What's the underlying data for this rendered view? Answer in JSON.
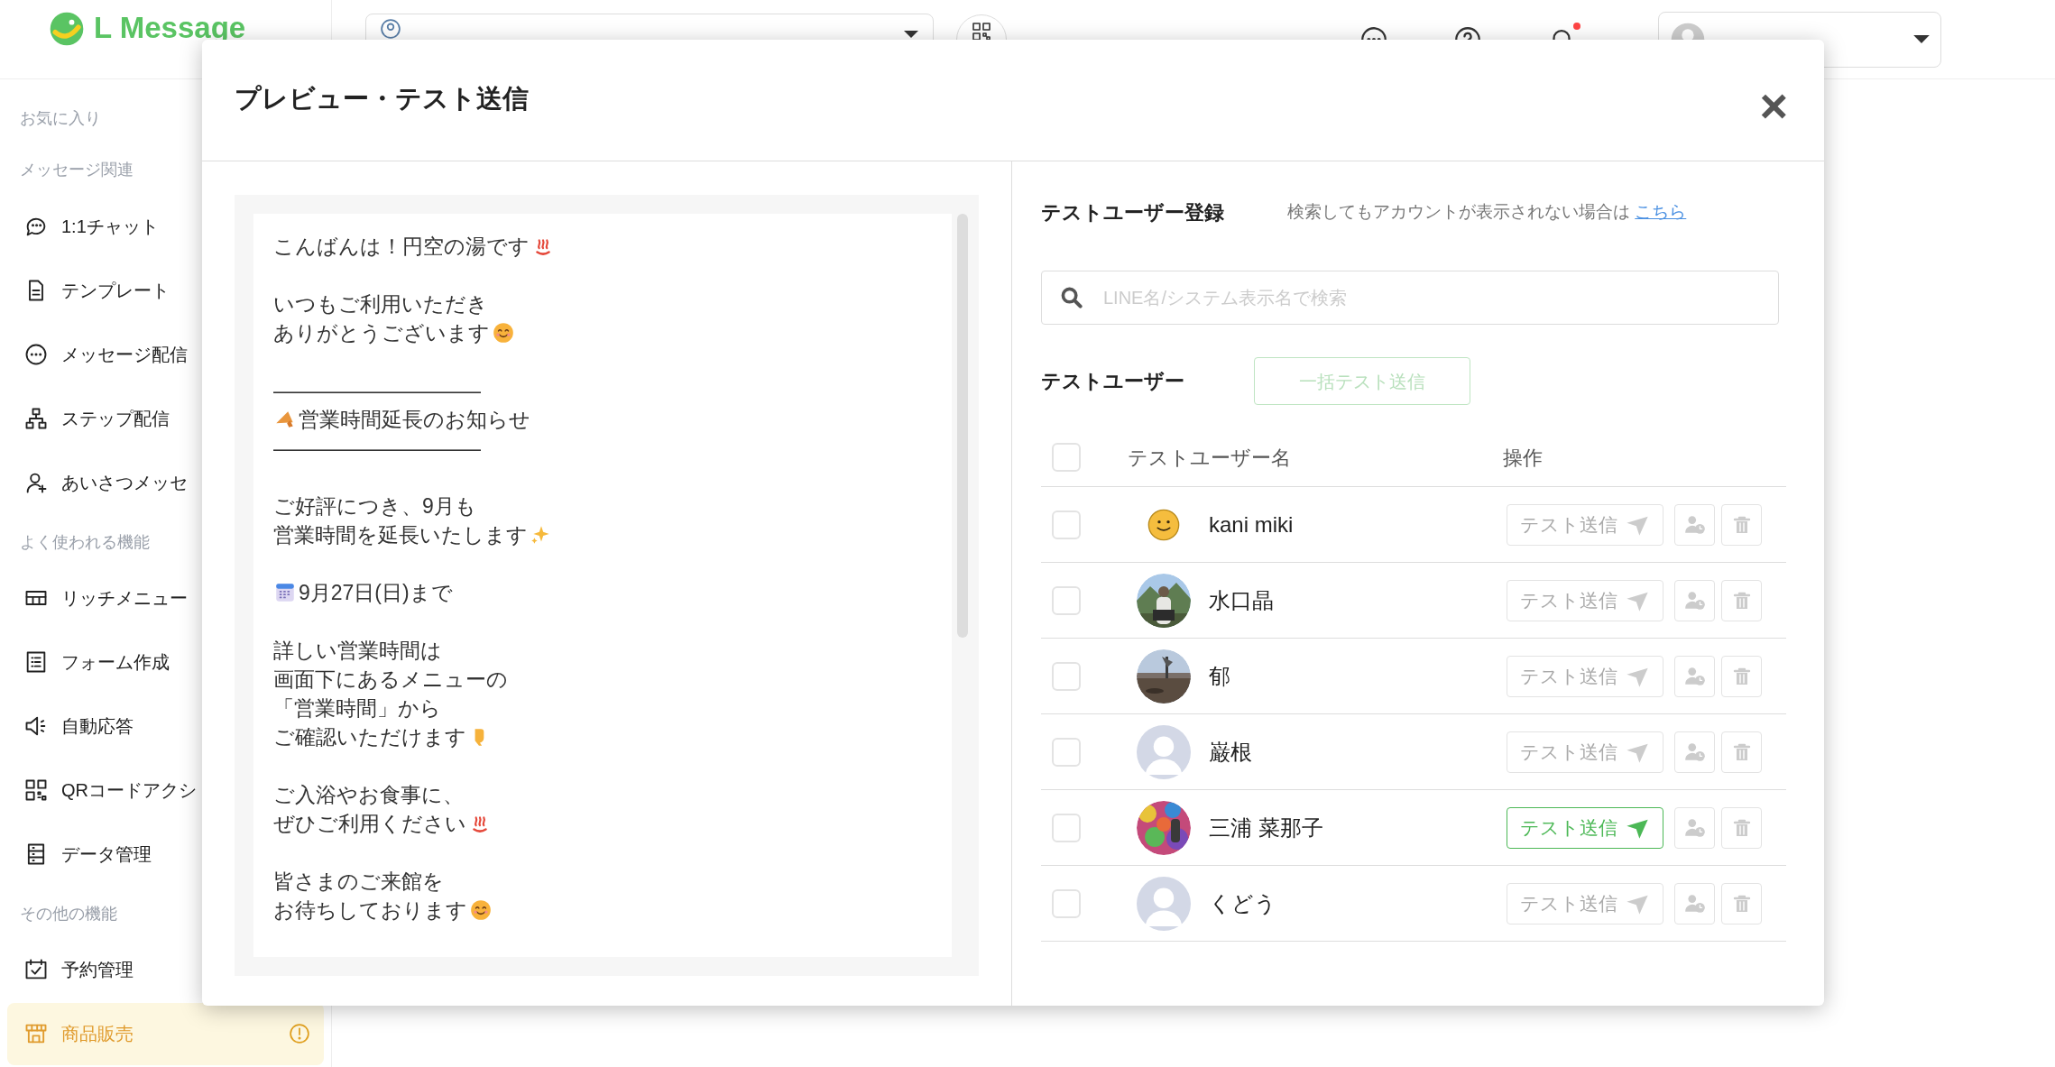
{
  "header": {
    "logo": "L Message",
    "notification": true
  },
  "sidebar": {
    "sections": [
      {
        "label": "お気に入り"
      },
      {
        "label": "メッセージ関連",
        "items": [
          {
            "label": "1:1チャット",
            "kind": "chat",
            "selected": false
          },
          {
            "label": "テンプレート",
            "kind": "document",
            "selected": false
          },
          {
            "label": "メッセージ配信",
            "kind": "bubble",
            "selected": false
          },
          {
            "label": "ステップ配信",
            "kind": "steps",
            "selected": false
          },
          {
            "label": "あいさつメッセ",
            "kind": "user-plus",
            "selected": false
          }
        ]
      },
      {
        "label": "よく使われる機能",
        "items": [
          {
            "label": "リッチメニュー",
            "kind": "grid",
            "selected": false
          },
          {
            "label": "フォーム作成",
            "kind": "form",
            "selected": false
          },
          {
            "label": "自動応答",
            "kind": "speaker",
            "selected": false
          },
          {
            "label": "QRコードアクシ",
            "kind": "qr",
            "selected": false
          },
          {
            "label": "データ管理",
            "kind": "data",
            "selected": false
          }
        ]
      },
      {
        "label": "その他の機能",
        "items": [
          {
            "label": "予約管理",
            "kind": "calendar",
            "selected": false
          },
          {
            "label": "商品販売",
            "kind": "store",
            "selected": true,
            "warning": true
          }
        ]
      }
    ]
  },
  "modal": {
    "title": "プレビュー・テスト送信",
    "close": "×",
    "message": [
      [
        {
          "text": "こんばんは！円空の湯です",
          "kind": "hotspring"
        }
      ],
      [
        {
          "text": "いつもご利用いただき",
          "kind": "plain"
        },
        {
          "text": "ありがとうございます",
          "kind": "smile"
        }
      ],
      [
        {
          "text": "――――――――――",
          "kind": "plain"
        },
        {
          "text": "営業時間延長のお知らせ",
          "kind": "megaphone-first"
        },
        {
          "text": "――――――――――",
          "kind": "plain"
        }
      ],
      [
        {
          "text": "ご好評につき、9月も",
          "kind": "plain"
        },
        {
          "text": "営業時間を延長いたします",
          "kind": "sparkles"
        }
      ],
      [
        {
          "text": "9月27日(日)まで",
          "kind": "calendar-first"
        }
      ],
      [
        {
          "text": "詳しい営業時間は",
          "kind": "plain"
        },
        {
          "text": "画面下にあるメニューの",
          "kind": "plain"
        },
        {
          "text": "「営業時間」から",
          "kind": "plain"
        },
        {
          "text": "ご確認いただけます",
          "kind": "pointing"
        }
      ],
      [
        {
          "text": "ご入浴やお食事に、",
          "kind": "plain"
        },
        {
          "text": "ぜひご利用ください",
          "kind": "hotspring"
        }
      ],
      [
        {
          "text": "皆さまのご来館を",
          "kind": "plain"
        },
        {
          "text": "お待ちしております",
          "kind": "smile"
        }
      ]
    ],
    "register": {
      "title": "テストユーザー登録",
      "note": "検索してもアカウントが表示されない場合は",
      "link": "こちら",
      "search": {
        "placeholder": "LINE名/システム表示名で検索"
      }
    },
    "users": {
      "title": "テストユーザー",
      "bulk_button": {
        "label": "一括テスト送信",
        "disabled": true
      },
      "columns": [
        "テストユーザー名",
        "操作"
      ],
      "header_checked": false,
      "rows": [
        {
          "name": "kani miki",
          "kind": "smiley",
          "checked": false,
          "send": {
            "label": "テスト送信",
            "active": false
          }
        },
        {
          "name": "水口晶",
          "checked": false,
          "send": {
            "label": "テスト送信",
            "active": false
          }
        },
        {
          "name": "郁",
          "checked": false,
          "send": {
            "label": "テスト送信",
            "active": false
          }
        },
        {
          "name": "巌根",
          "kind": "default",
          "checked": false,
          "send": {
            "label": "テスト送信",
            "active": false
          }
        },
        {
          "name": "三浦 菜那子",
          "checked": false,
          "send": {
            "label": "テスト送信",
            "active": true
          }
        },
        {
          "name": "くどう",
          "kind": "default",
          "checked": false,
          "send": {
            "label": "テスト送信",
            "active": false
          }
        }
      ]
    }
  }
}
